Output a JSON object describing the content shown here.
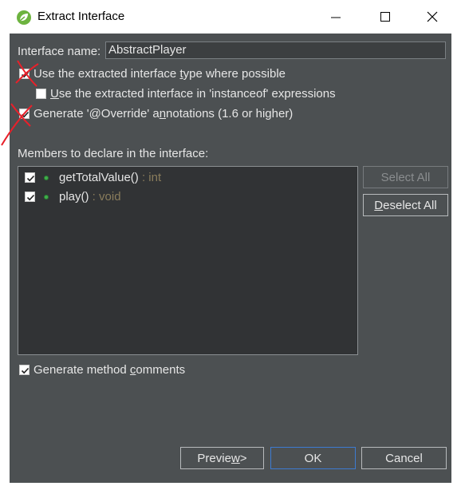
{
  "window": {
    "title": "Extract Interface"
  },
  "form": {
    "interface_name_label": "Interface name:",
    "interface_name_value": "AbstractPlayer",
    "opt_use_type": {
      "before": "Use the extracted interface ",
      "accel": "t",
      "after": "ype where possible",
      "checked": true
    },
    "opt_instanceof": {
      "before": "",
      "accel": "U",
      "after": "se the extracted interface in 'instanceof' expressions",
      "checked": false
    },
    "opt_override": {
      "before": "Generate '@Override' a",
      "accel": "n",
      "after": "notations (1.6 or higher)",
      "checked": true
    },
    "members_label": "Members to declare in the interface:",
    "members": [
      {
        "name": "getTotalValue()",
        "type": " : int",
        "checked": true
      },
      {
        "name": "play()",
        "type": " : void",
        "checked": true
      }
    ],
    "opt_comments": {
      "before": "Generate method ",
      "accel": "c",
      "after": "omments",
      "checked": true
    }
  },
  "buttons": {
    "select_all": "Select All",
    "deselect_all": {
      "before": "",
      "accel": "D",
      "after": "eselect All"
    },
    "preview": {
      "before": "Previe",
      "accel": "w",
      "after": " >"
    },
    "ok": "OK",
    "cancel": "Cancel"
  },
  "colors": {
    "dialog_bg": "#4c5052",
    "list_bg": "#313335",
    "method_icon": "#3fae4a",
    "return_type": "#8a7d5c",
    "annotation_mark": "#e8202a",
    "default_button_border": "#3d7bd1"
  },
  "icons": {
    "app": "eclipse-leaf-icon",
    "minimize": "minimize-icon",
    "maximize": "maximize-icon",
    "close": "close-icon",
    "method": "public-method-icon"
  }
}
